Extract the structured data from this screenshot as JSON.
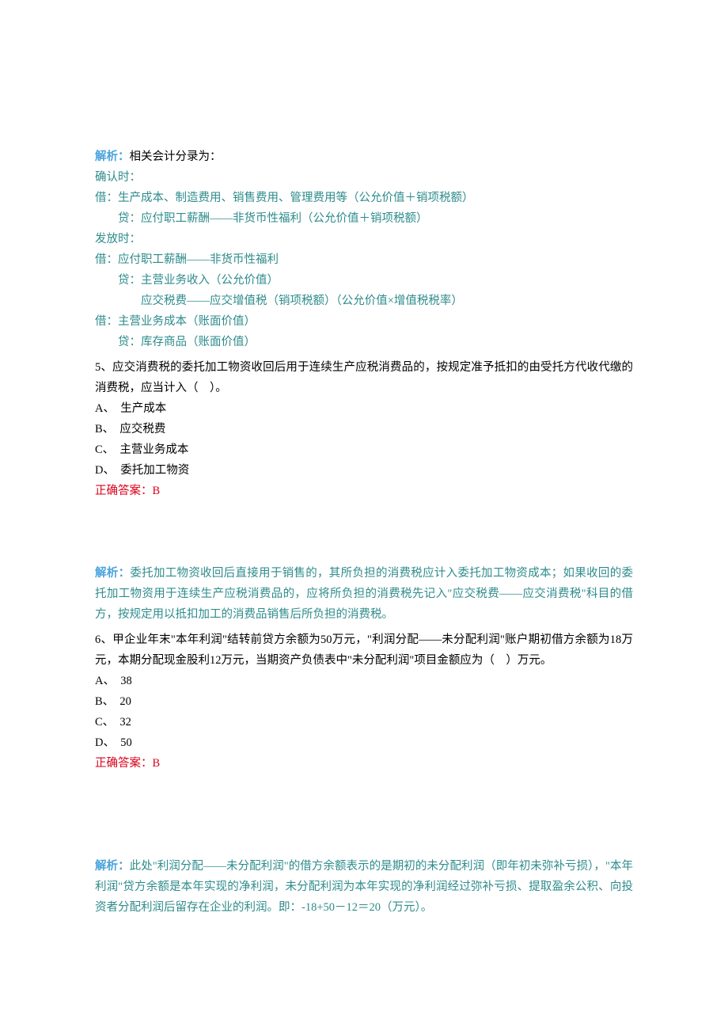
{
  "labels": {
    "analysis": "解析：",
    "correct": "正确答案："
  },
  "analysis4": {
    "intro": "相关会计分录为：",
    "l1": "确认时：",
    "l2": "借：生产成本、制造费用、销售费用、管理费用等（公允价值＋销项税额）",
    "l3": "贷：应付职工薪酬——非货币性福利（公允价值＋销项税额）",
    "l4": "发放时：",
    "l5": "借：应付职工薪酬——非货币性福利",
    "l6": "贷：主营业务收入（公允价值）",
    "l7": "应交税费——应交增值税（销项税额）（公允价值×增值税税率）",
    "l8": "借：主营业务成本（账面价值）",
    "l9": "贷：库存商品（账面价值）"
  },
  "q5": {
    "stem": "5、应交消费税的委托加工物资收回后用于连续生产应税消费品的，按规定准予抵扣的由受托方代收代缴的消费税，应当计入（　）。",
    "A": "A、　生产成本",
    "B": "B、　应交税费",
    "C": "C、　主营业务成本",
    "D": "D、　委托加工物资",
    "answer": "B",
    "analysis": "委托加工物资收回后直接用于销售的，其所负担的消费税应计入委托加工物资成本；如果收回的委托加工物资用于连续生产应税消费品的，应将所负担的消费税先记入\"应交税费——应交消费税\"科目的借方，按规定用以抵扣加工的消费品销售后所负担的消费税。"
  },
  "q6": {
    "stem": "6、甲企业年末\"本年利润\"结转前贷方余额为50万元，\"利润分配——未分配利润\"账户期初借方余额为18万元，本期分配现金股利12万元，当期资产负债表中\"未分配利润\"项目金额应为（　）万元。",
    "A": "A、　38",
    "B": "B、　20",
    "C": "C、　32",
    "D": "D、　50",
    "answer": "B",
    "analysis": "此处\"利润分配——未分配利润\"的借方余额表示的是期初的未分配利润（即年初未弥补亏损），\"本年利润\"贷方余额是本年实现的净利润，未分配利润为本年实现的净利润经过弥补亏损、提取盈余公积、向投资者分配利润后留存在企业的利润。即：-18+50－12＝20（万元）。"
  }
}
